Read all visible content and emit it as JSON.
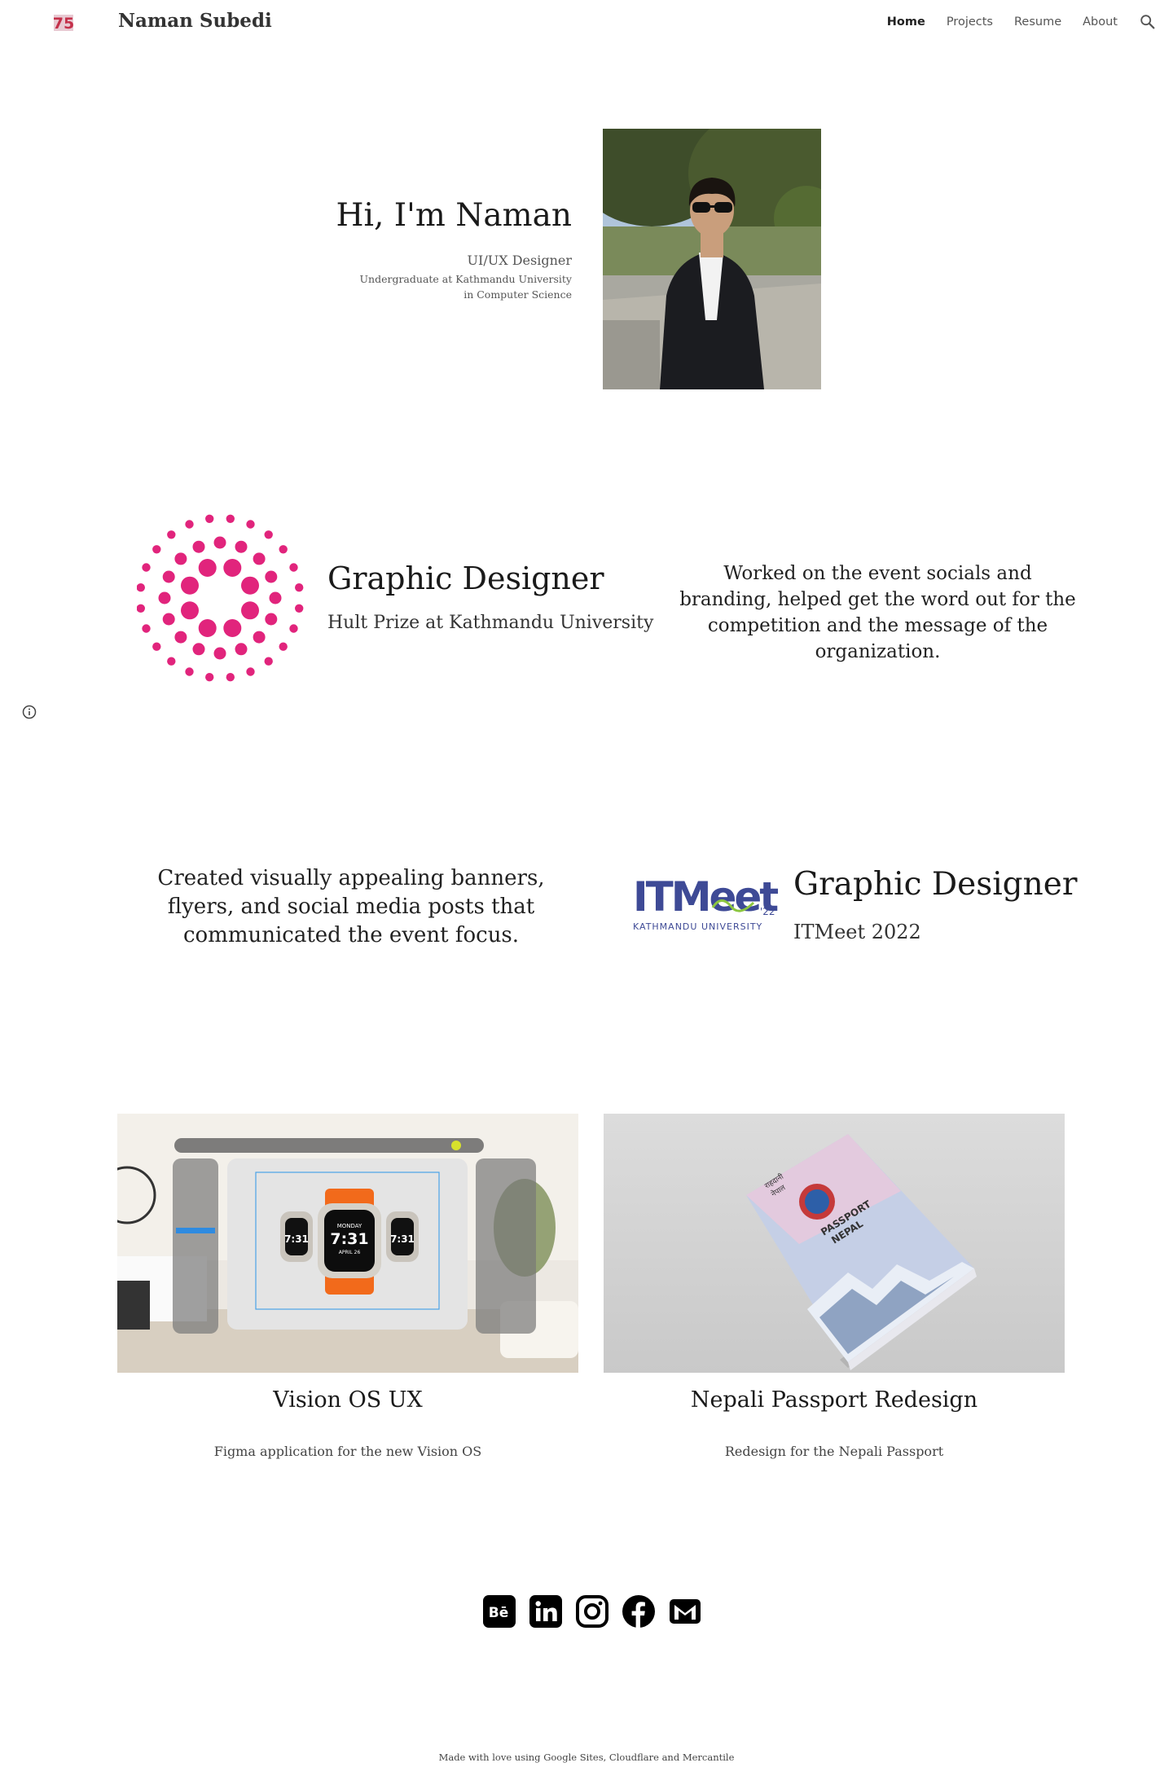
{
  "header": {
    "site_title": "Naman Subedi",
    "nav": [
      "Home",
      "Projects",
      "Resume",
      "About"
    ],
    "active_nav": "Home",
    "logo_text": "75"
  },
  "hero": {
    "title": "Hi, I'm Naman",
    "role": "UI/UX Designer",
    "subtitle": "Undergraduate at Kathmandu University\nin Computer Science"
  },
  "experience": [
    {
      "title": "Graphic Designer",
      "org": "Hult Prize at Kathmandu University",
      "description": "Worked on the event socials and branding, helped get the word out for the competition and the message of the organization.",
      "accent": "#e1247c"
    },
    {
      "title": "Graphic Designer",
      "org": "ITMeet 2022",
      "description": "Created visually appealing banners, flyers, and social media posts that communicated the event focus.",
      "logo_main": "ITMeet",
      "logo_year": "'22",
      "logo_sub": "KATHMANDU UNIVERSITY",
      "accent": "#3e4a96"
    }
  ],
  "projects": [
    {
      "title": "Vision OS UX",
      "description": "Figma application for the new Vision OS",
      "watch_time": "7:31",
      "watch_day": "MONDAY",
      "watch_date": "APRIL 26"
    },
    {
      "title": "Nepali Passport Redesign",
      "description": "Redesign for the Nepali Passport",
      "cover_text_1": "PASSPORT",
      "cover_text_2": "NEPAL",
      "cover_nepali_1": "राहदानी",
      "cover_nepali_2": "नेपाल"
    }
  ],
  "social": [
    "behance-icon",
    "linkedin-icon",
    "instagram-icon",
    "facebook-icon",
    "gmail-icon"
  ],
  "footer": "Made with love using Google Sites, Cloudflare and Mercantile"
}
